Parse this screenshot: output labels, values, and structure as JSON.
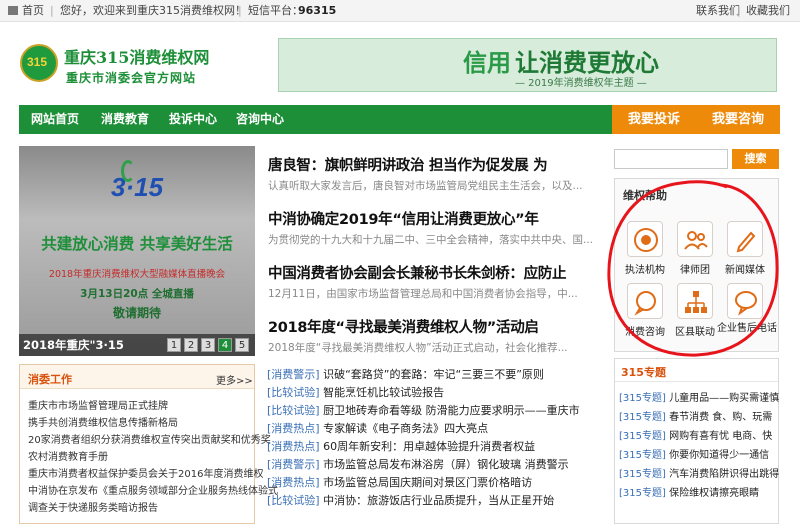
{
  "topbar": {
    "home": "首页",
    "welcome": "您好，欢迎来到重庆315消费维权网！",
    "sms_label": "短信平台：",
    "sms_number": "96315",
    "contact": "联系我们",
    "favorite": "收藏我们"
  },
  "logo": {
    "title": "重庆315消费维权网",
    "subtitle": "重庆市消委会官方网站"
  },
  "banner": {
    "headline_a": "信用",
    "headline_b": "让消费更放心",
    "sub": "— 2019年消费维权年主题 —"
  },
  "nav": {
    "items": [
      "网站首页",
      "消费教育",
      "投诉中心",
      "咨询中心"
    ],
    "complain": "我要投诉",
    "consult": "我要咨询"
  },
  "slide": {
    "title": "共建放心消费  共享美好生活",
    "event": "2018年重庆消费维权大型融媒体直播晚会",
    "time": "3月13日20点  全城直播",
    "expect": "敬请期待",
    "caption": "2018年重庆\"3·15",
    "pages": [
      "1",
      "2",
      "3",
      "4",
      "5"
    ],
    "active_page": "4",
    "colors": {
      "green": "#1e8f39",
      "red": "#c62b2b"
    }
  },
  "headlines": [
    {
      "title": "唐良智：旗帜鲜明讲政治 担当作为促发展 为",
      "summary": "认真听取大家发言后，唐良智对市场监管局党组民主生活会，以及..."
    },
    {
      "title": "中消协确定2019年“信用让消费更放心”年",
      "summary": "为贯彻党的十九大和十九届二中、三中全会精神，落实中共中央、国..."
    },
    {
      "title": "中国消费者协会副会长兼秘书长朱剑桥：应防止",
      "summary": "12月11日，由国家市场监督管理总局和中国消费者协会指导，中..."
    },
    {
      "title": "2018年度“寻找最美消费维权人物”活动启",
      "summary": "2018年度“寻找最美消费维权人物”活动正式启动，社会化推荐..."
    }
  ],
  "work": {
    "title": "消委工作",
    "more": "更多>>",
    "items": [
      "重庆市市场监督管理局正式挂牌",
      "携手共创消费维权信息传播新格局",
      "20家消费者组织分获消费维权宣传突出贡献奖和优秀奖",
      "农村消费教育手册",
      "重庆市消费者权益保护委员会关于2016年度消费维权",
      "中消协在京发布《重点服务领域部分企业服务热线体验式",
      "调查关于快递服务类暗访报告"
    ]
  },
  "news": [
    {
      "tag": "[消费警示]",
      "text": "识破“套路贷”的套路：牢记“三要三不要”原则"
    },
    {
      "tag": "[比较试验]",
      "text": "智能烹饪机比较试验报告"
    },
    {
      "tag": "[比较试验]",
      "text": "厨卫地砖寿命看等级 防滑能力应要求明示——重庆市"
    },
    {
      "tag": "[消费热点]",
      "text": "专家解读《电子商务法》四大亮点"
    },
    {
      "tag": "[消费热点]",
      "text": "60周年新安利：用卓越体验提升消费者权益"
    },
    {
      "tag": "[消费警示]",
      "text": "市场监管总局发布淋浴房（屏）钢化玻璃 消费警示"
    },
    {
      "tag": "[消费热点]",
      "text": "市场监管总局国庆期间对景区门票价格暗访"
    },
    {
      "tag": "[比较试验]",
      "text": "中消协：旅游饭店行业品质提升，当从正星开始"
    }
  ],
  "search": {
    "placeholder": "",
    "button": "搜索"
  },
  "help": {
    "title": "维权帮助",
    "items": [
      {
        "label": "执法机构",
        "icon": "emblem-icon"
      },
      {
        "label": "律师团",
        "icon": "group-icon"
      },
      {
        "label": "新闻媒体",
        "icon": "pen-icon"
      },
      {
        "label": "消费咨询",
        "icon": "chat-icon"
      },
      {
        "label": "区县联动",
        "icon": "network-icon"
      },
      {
        "label": "企业售后电话",
        "icon": "speech-icon"
      }
    ],
    "highlight_color": "#e8141c"
  },
  "topics": {
    "title": "315专题",
    "items": [
      {
        "tag": "[315专题]",
        "text": "儿童用品——购买需谨慎"
      },
      {
        "tag": "[315专题]",
        "text": "春节消费 食、购、玩需"
      },
      {
        "tag": "[315专题]",
        "text": "网购有喜有忧 电商、快"
      },
      {
        "tag": "[315专题]",
        "text": "你要你知道得少一通信"
      },
      {
        "tag": "[315专题]",
        "text": "汽车消费陷阱识得出跳得"
      },
      {
        "tag": "[315专题]",
        "text": "保险维权请擦亮眼睛"
      }
    ]
  }
}
